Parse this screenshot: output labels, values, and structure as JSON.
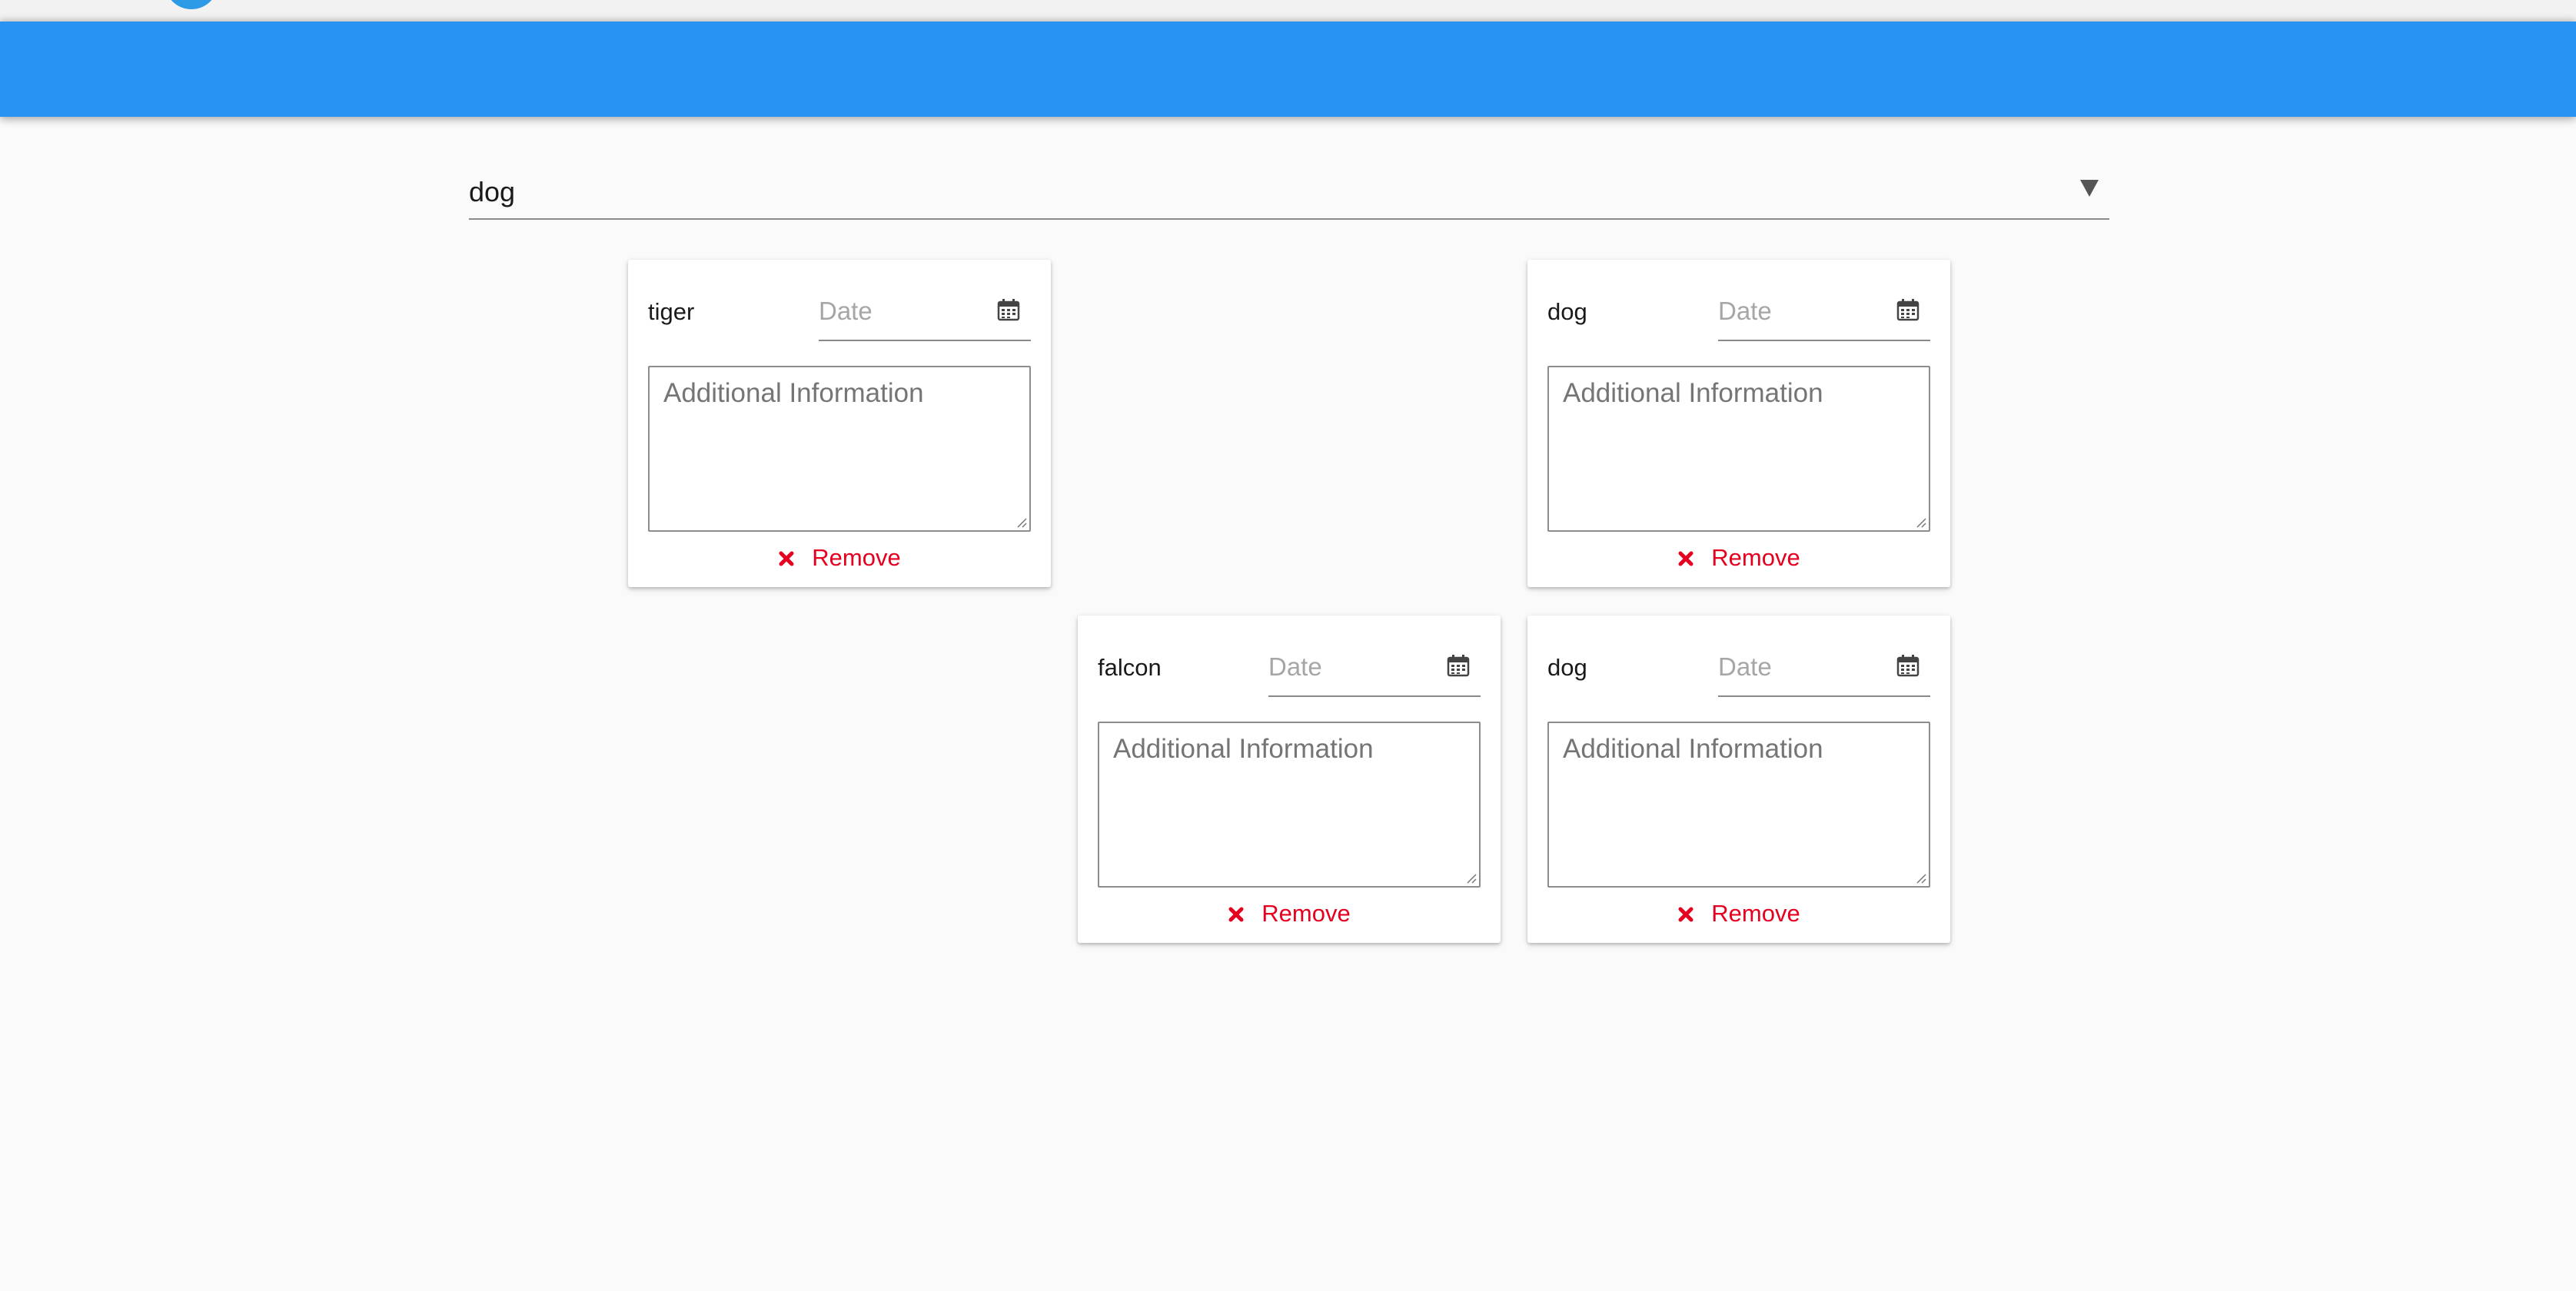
{
  "select": {
    "value": "dog"
  },
  "cards": [
    {
      "name": "tiger",
      "date_placeholder": "Date",
      "info_placeholder": "Additional Information",
      "remove_label": "Remove"
    },
    {
      "name": "dog",
      "date_placeholder": "Date",
      "info_placeholder": "Additional Information",
      "remove_label": "Remove"
    },
    {
      "name": "falcon",
      "date_placeholder": "Date",
      "info_placeholder": "Additional Information",
      "remove_label": "Remove"
    },
    {
      "name": "dog",
      "date_placeholder": "Date",
      "info_placeholder": "Additional Information",
      "remove_label": "Remove"
    }
  ],
  "icons": {
    "calendar": "calendar-icon",
    "remove": "close-x-icon",
    "dropdown": "triangle-down-icon"
  },
  "colors": {
    "app_bar": "#2893f3",
    "avatar": "#2d9ae6",
    "remove": "#e6001f",
    "background": "#fafafa"
  }
}
